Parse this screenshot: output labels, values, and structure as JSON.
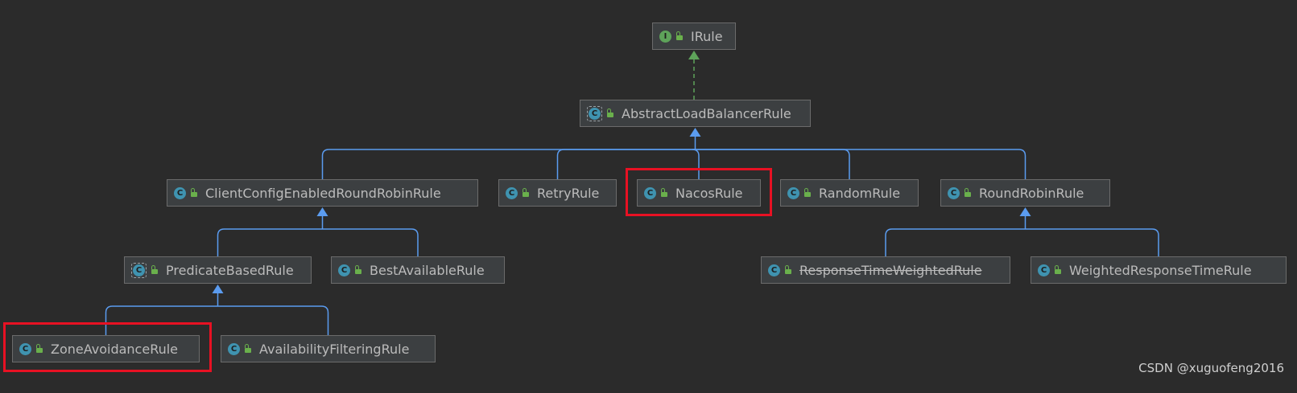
{
  "diagram": {
    "nodes": {
      "irule": {
        "name": "IRule",
        "kind": "interface",
        "kind_letter": "I"
      },
      "abstract": {
        "name": "AbstractLoadBalancerRule",
        "kind": "abstract",
        "kind_letter": "C"
      },
      "clientconfig": {
        "name": "ClientConfigEnabledRoundRobinRule",
        "kind": "class",
        "kind_letter": "C"
      },
      "retry": {
        "name": "RetryRule",
        "kind": "class",
        "kind_letter": "C"
      },
      "nacos": {
        "name": "NacosRule",
        "kind": "class",
        "kind_letter": "C"
      },
      "random": {
        "name": "RandomRule",
        "kind": "class",
        "kind_letter": "C"
      },
      "roundrobin": {
        "name": "RoundRobinRule",
        "kind": "class",
        "kind_letter": "C"
      },
      "predicate": {
        "name": "PredicateBasedRule",
        "kind": "abstract",
        "kind_letter": "C"
      },
      "bestavailable": {
        "name": "BestAvailableRule",
        "kind": "class",
        "kind_letter": "C"
      },
      "responsetime": {
        "name": "ResponseTimeWeightedRule",
        "kind": "class",
        "kind_letter": "C",
        "deprecated": true
      },
      "weightedresponse": {
        "name": "WeightedResponseTimeRule",
        "kind": "class",
        "kind_letter": "C"
      },
      "zoneavoidance": {
        "name": "ZoneAvoidanceRule",
        "kind": "class",
        "kind_letter": "C"
      },
      "availability": {
        "name": "AvailabilityFilteringRule",
        "kind": "class",
        "kind_letter": "C"
      }
    },
    "edges": [
      {
        "from": "abstract",
        "to": "irule",
        "type": "implements"
      },
      {
        "from": "clientconfig",
        "to": "abstract",
        "type": "extends"
      },
      {
        "from": "retry",
        "to": "abstract",
        "type": "extends"
      },
      {
        "from": "nacos",
        "to": "abstract",
        "type": "extends"
      },
      {
        "from": "random",
        "to": "abstract",
        "type": "extends"
      },
      {
        "from": "roundrobin",
        "to": "abstract",
        "type": "extends"
      },
      {
        "from": "predicate",
        "to": "clientconfig",
        "type": "extends"
      },
      {
        "from": "bestavailable",
        "to": "clientconfig",
        "type": "extends"
      },
      {
        "from": "responsetime",
        "to": "roundrobin",
        "type": "extends"
      },
      {
        "from": "weightedresponse",
        "to": "roundrobin",
        "type": "extends"
      },
      {
        "from": "zoneavoidance",
        "to": "predicate",
        "type": "extends"
      },
      {
        "from": "availability",
        "to": "predicate",
        "type": "extends"
      }
    ],
    "highlighted": [
      "nacos",
      "zoneavoidance"
    ]
  },
  "colors": {
    "background": "#2b2b2b",
    "node_fill": "#3c3f41",
    "node_border": "#6b6b6b",
    "text": "#bbbbbb",
    "extends_edge": "#5b9cf0",
    "implements_edge": "#5ea35a",
    "highlight": "#e81123",
    "class_icon": "#3f93b0",
    "interface_icon": "#5ea35a"
  },
  "watermark": "CSDN @xuguofeng2016"
}
